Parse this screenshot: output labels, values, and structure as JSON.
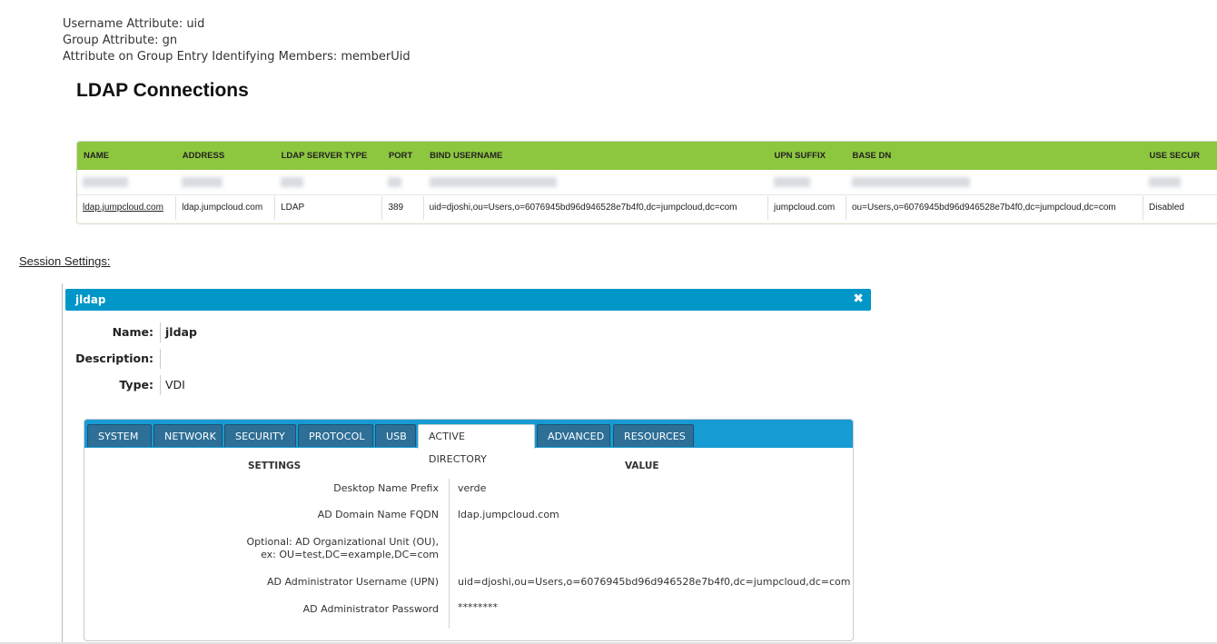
{
  "attributes": {
    "username": "Username Attribute: uid",
    "group": "Group Attribute: gn",
    "members": "Attribute on Group Entry Identifying Members: memberUid"
  },
  "heading": "LDAP Connections",
  "ldap_table": {
    "columns": [
      "NAME",
      "ADDRESS",
      "LDAP SERVER TYPE",
      "PORT",
      "BIND USERNAME",
      "UPN SUFFIX",
      "BASE DN",
      "USE SECUR"
    ],
    "rows": [
      {
        "name": "ldap.jumpcloud.com",
        "address": "ldap.jumpcloud.com",
        "server_type": "LDAP",
        "port": "389",
        "bind_username": "uid=djoshi,ou=Users,o=6076945bd96d946528e7b4f0,dc=jumpcloud,dc=com",
        "upn_suffix": "jumpcloud.com",
        "base_dn": "ou=Users,o=6076945bd96d946528e7b4f0,dc=jumpcloud,dc=com",
        "use_secure": "Disabled"
      }
    ]
  },
  "session_label": "Session Settings:",
  "dialog": {
    "title": "jldap",
    "close_glyph": "✖",
    "name_label": "Name:",
    "name_value": "jldap",
    "description_label": "Description:",
    "description_value": "",
    "type_label": "Type:",
    "type_value": "VDI"
  },
  "tabs": [
    "SYSTEM",
    "NETWORK",
    "SECURITY",
    "PROTOCOL",
    "USB",
    "ACTIVE DIRECTORY",
    "ADVANCED",
    "RESOURCES"
  ],
  "active_tab": "ACTIVE DIRECTORY",
  "settings": {
    "col_settings": "SETTINGS",
    "col_value": "VALUE",
    "rows": [
      {
        "label": "Desktop Name Prefix",
        "value": "verde"
      },
      {
        "label": "AD Domain Name FQDN",
        "value": "ldap.jumpcloud.com"
      },
      {
        "label_line1": "Optional: AD Organizational Unit (OU),",
        "label_line2": "ex: OU=test,DC=example,DC=com",
        "value": ""
      },
      {
        "label": "AD Administrator Username (UPN)",
        "value": "uid=djoshi,ou=Users,o=6076945bd96d946528e7b4f0,dc=jumpcloud,dc=com"
      },
      {
        "label": "AD Administrator Password",
        "value": "********"
      }
    ]
  },
  "colors": {
    "table_header": "#8dc63f",
    "dialog_header": "#0096c8",
    "tab_bar": "#179bd3",
    "tab": "#2d6f97"
  }
}
